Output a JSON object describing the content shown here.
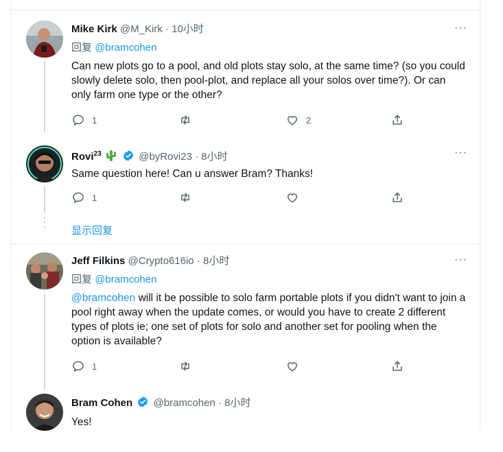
{
  "tweets": [
    {
      "name": "Mike Kirk",
      "handle": "@M_Kirk",
      "dot": "·",
      "time": "10小时",
      "reply_prefix": "回复",
      "reply_to": "@bramcohen",
      "body": "Can new plots go to a pool, and old plots stay solo, at the same time? (so you could slowly delete solo, then pool-plot, and replace all your solos over time?). Or can only farm one type or the other?",
      "reply_count": "1",
      "retweet_count": "",
      "like_count": "2",
      "more": "···"
    },
    {
      "name": "Rovi",
      "name_sup": "23",
      "emoji": "cactus",
      "handle": "@byRovi23",
      "dot": "·",
      "time": "8小时",
      "body": "Same question here! Can u answer Bram? Thanks!",
      "reply_count": "1",
      "more": "···"
    },
    {
      "name": "Jeff Filkins",
      "handle": "@Crypto616io",
      "dot": "·",
      "time": "8小时",
      "reply_prefix": "回复",
      "reply_to": "@bramcohen",
      "body_mention": "@bramcohen",
      "body": " will it be possible to solo farm portable plots if you didn't want to join a pool right away when the update comes, or would you have to create 2 different types of plots ie; one set of plots for solo and another set for pooling when the option is available?",
      "reply_count": "1",
      "more": "···"
    },
    {
      "name": "Bram Cohen",
      "handle": "@bramcohen",
      "dot": "·",
      "time": "8小时",
      "body": "Yes!"
    }
  ],
  "show_replies": "显示回复",
  "colors": {
    "accent": "#1b95e0",
    "verified": "#1d9bf0",
    "muted": "#536471"
  }
}
